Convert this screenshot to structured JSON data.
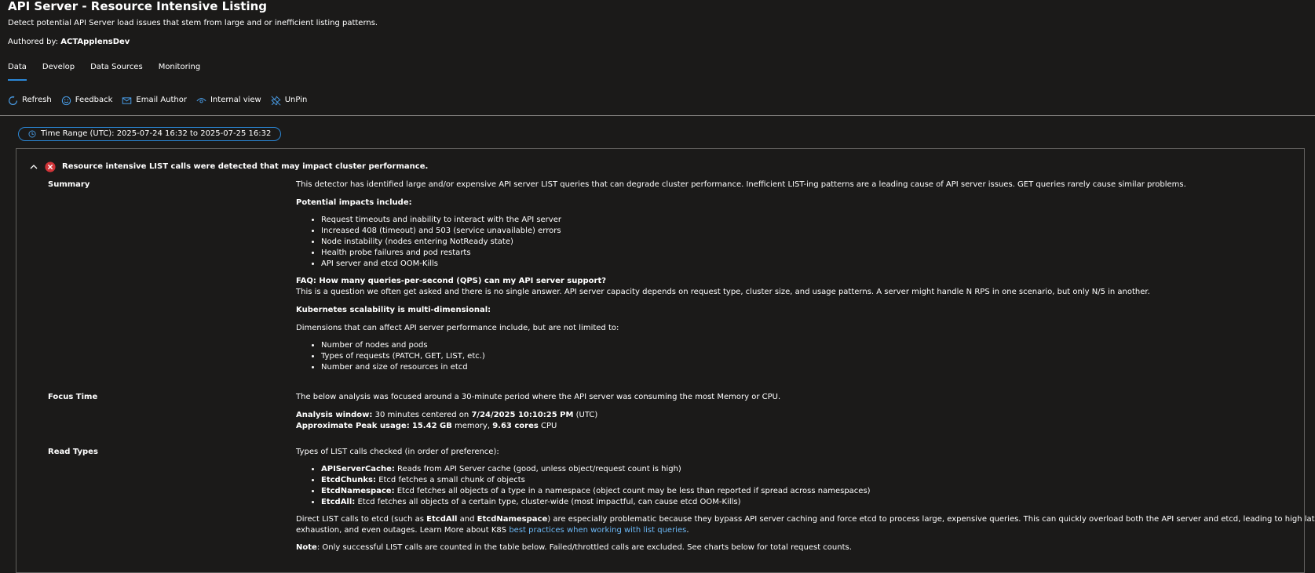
{
  "header": {
    "title": "API Server - Resource Intensive Listing",
    "description": "Detect potential API Server load issues that stem from large and or inefficient listing patterns.",
    "author_label": "Authored by:",
    "author_name": "ACTApplensDev"
  },
  "tabs": [
    {
      "label": "Data"
    },
    {
      "label": "Develop"
    },
    {
      "label": "Data Sources"
    },
    {
      "label": "Monitoring"
    }
  ],
  "commands": {
    "refresh": "Refresh",
    "feedback": "Feedback",
    "email_author": "Email Author",
    "internal_view": "Internal view",
    "unpin": "UnPin"
  },
  "time_range": "Time Range (UTC): 2025-07-24 16:32 to 2025-07-25 16:32",
  "insight": {
    "title": "Resource intensive LIST calls were detected that may impact cluster performance.",
    "summary": {
      "label": "Summary",
      "intro": "This detector has identified large and/or expensive API server LIST queries that can degrade cluster performance. Inefficient LIST-ing patterns are a leading cause of API server issues. GET queries rarely cause similar problems.",
      "impacts_heading": "Potential impacts include:",
      "impacts": [
        "Request timeouts and inability to interact with the API server",
        "Increased 408 (timeout) and 503 (service unavailable) errors",
        "Node instability (nodes entering NotReady state)",
        "Health probe failures and pod restarts",
        "API server and etcd OOM-Kills"
      ],
      "faq_q": "FAQ: How many queries-per-second (QPS) can my API server support?",
      "faq_a": "This is a question we often get asked and there is no single answer. API server capacity depends on request type, cluster size, and usage patterns. A server might handle N RPS in one scenario, but only N/5 in another.",
      "scal_heading": "Kubernetes scalability is multi-dimensional:",
      "dims_intro": "Dimensions that can affect API server performance include, but are not limited to:",
      "dims": [
        "Number of nodes and pods",
        "Types of requests (PATCH, GET, LIST, etc.)",
        "Number and size of resources in etcd"
      ]
    },
    "focus": {
      "label": "Focus Time",
      "intro": "The below analysis was focused around a 30-minute period where the API server was consuming the most Memory or CPU.",
      "aw_label": "Analysis window:",
      "aw_text1": "30 minutes centered on",
      "aw_time": "7/24/2025 10:10:25 PM",
      "aw_tz": "(UTC)",
      "peak_label": "Approximate Peak usage:",
      "peak_mem": "15.42 GB",
      "peak_mem_unit": "memory,",
      "peak_cpu": "9.63 cores",
      "peak_cpu_unit": "CPU"
    },
    "read_types": {
      "label": "Read Types",
      "intro": "Types of LIST calls checked (in order of preference):",
      "items": [
        {
          "name": "APIServerCache:",
          "desc": "Reads from API Server cache (good, unless object/request count is high)"
        },
        {
          "name": "EtcdChunks:",
          "desc": "Etcd fetches a small chunk of objects"
        },
        {
          "name": "EtcdNamespace:",
          "desc": "Etcd fetches all objects of a type in a namespace (object count may be less than reported if spread across namespaces)"
        },
        {
          "name": "EtcdAll:",
          "desc": "Etcd fetches all objects of a certain type, cluster-wide (most impactful, can cause etcd OOM-Kills)"
        }
      ],
      "direct_1": "Direct LIST calls to etcd (such as",
      "direct_b1": "EtcdAll",
      "direct_2": "and",
      "direct_b2": "EtcdNamespace",
      "direct_3": ") are especially problematic because they bypass API server caching and force etcd to process large, expensive queries. This can quickly overload both the API server and etcd, leading to high latency, resource",
      "direct_4": "exhaustion, and even outages. Learn More about K8S",
      "direct_link": "best practices when working with list queries",
      "direct_5": ".",
      "note_label": "Note",
      "note_text": ": Only successful LIST calls are counted in the table below. Failed/throttled calls are excluded. See charts below for total request counts."
    }
  }
}
